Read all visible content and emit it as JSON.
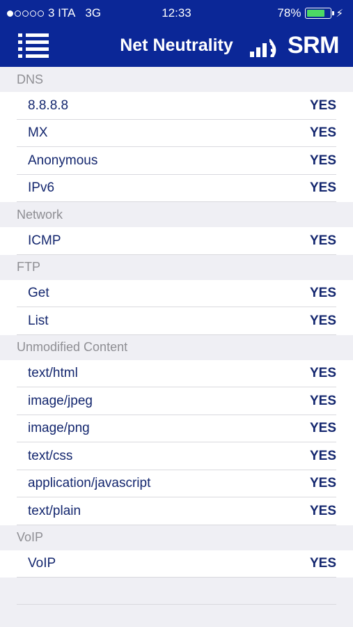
{
  "status_bar": {
    "carrier": "3 ITA",
    "network": "3G",
    "time": "12:33",
    "battery": "78%",
    "battery_level": 0.78,
    "battery_color": "#4cd964"
  },
  "nav": {
    "title": "Net Neutrality",
    "menu_icon": "list-menu-icon",
    "brand_name": "SRM",
    "brand_icon": "signal-waves-icon"
  },
  "colors": {
    "header_bg": "#0b2797",
    "text": "#13266e",
    "section_text": "#8e8e93",
    "background": "#efeff4"
  },
  "sections": [
    {
      "title": "DNS",
      "items": [
        {
          "label": "8.8.8.8",
          "value": "YES"
        },
        {
          "label": "MX",
          "value": "YES"
        },
        {
          "label": "Anonymous",
          "value": "YES"
        },
        {
          "label": "IPv6",
          "value": "YES"
        }
      ]
    },
    {
      "title": "Network",
      "items": [
        {
          "label": "ICMP",
          "value": "YES"
        }
      ]
    },
    {
      "title": "FTP",
      "items": [
        {
          "label": "Get",
          "value": "YES"
        },
        {
          "label": "List",
          "value": "YES"
        }
      ]
    },
    {
      "title": "Unmodified Content",
      "items": [
        {
          "label": "text/html",
          "value": "YES"
        },
        {
          "label": "image/jpeg",
          "value": "YES"
        },
        {
          "label": "image/png",
          "value": "YES"
        },
        {
          "label": "text/css",
          "value": "YES"
        },
        {
          "label": "application/javascript",
          "value": "YES"
        },
        {
          "label": "text/plain",
          "value": "YES"
        }
      ]
    },
    {
      "title": "VoIP",
      "items": [
        {
          "label": "VoIP",
          "value": "YES"
        }
      ]
    }
  ]
}
